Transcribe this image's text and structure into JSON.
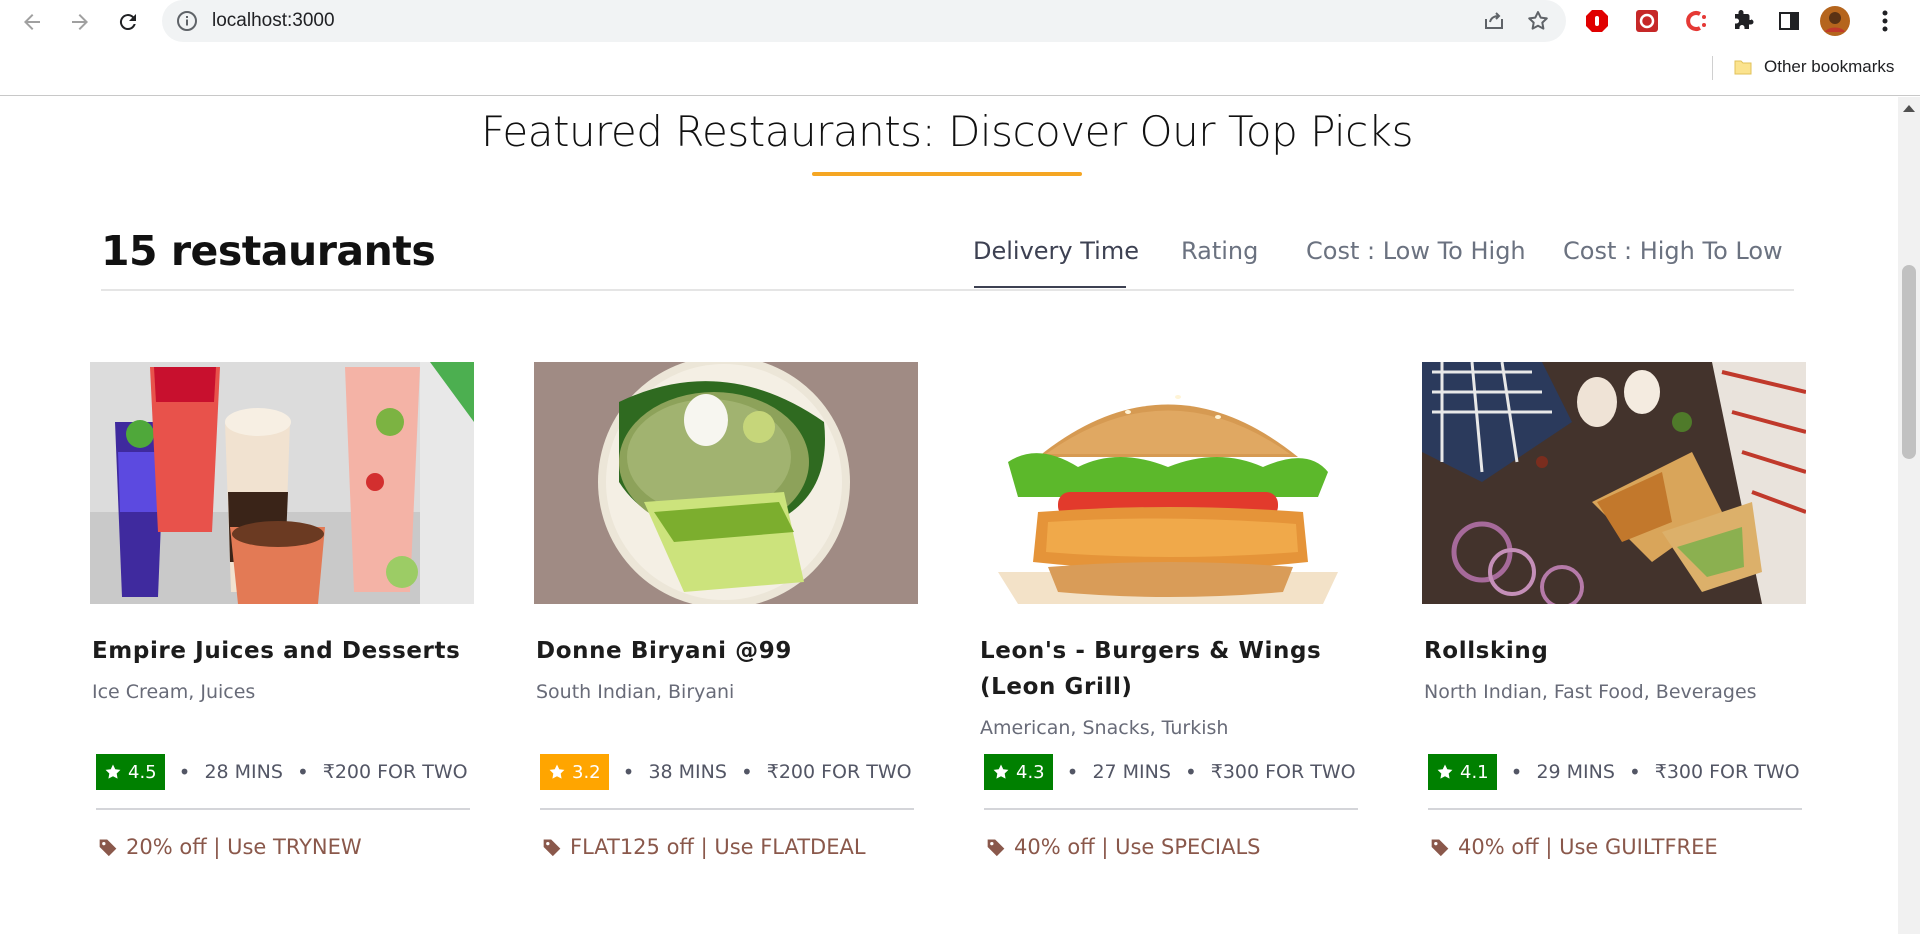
{
  "browser": {
    "url": "localhost:3000",
    "bookmarks_label": "Other bookmarks"
  },
  "page": {
    "heading": "Featured Restaurants: Discover Our Top Picks",
    "count_label": "15 restaurants",
    "sort_tabs": [
      "Delivery Time",
      "Rating",
      "Cost : Low To High",
      "Cost : High To Low"
    ],
    "active_sort": "Delivery Time",
    "accent_color": "#f5a623"
  },
  "restaurants": [
    {
      "name": "Empire Juices and Desserts",
      "cuisine": "Ice Cream, Juices",
      "rating": "4.5",
      "rating_color": "#008000",
      "time": "28 MINS",
      "cost": "₹200 FOR TWO",
      "offer": "20% off | Use TRYNEW",
      "image": "juices-desserts-photo"
    },
    {
      "name": "Donne Biryani @99",
      "cuisine": "South Indian, Biryani",
      "rating": "3.2",
      "rating_color": "#ffa500",
      "time": "38 MINS",
      "cost": "₹200 FOR TWO",
      "offer": "FLAT125 off | Use FLATDEAL",
      "image": "biryani-photo"
    },
    {
      "name": "Leon's - Burgers & Wings (Leon Grill)",
      "cuisine": "American, Snacks, Turkish",
      "rating": "4.3",
      "rating_color": "#008000",
      "time": "27 MINS",
      "cost": "₹300 FOR TWO",
      "offer": "40% off | Use SPECIALS",
      "image": "burger-photo"
    },
    {
      "name": "Rollsking",
      "cuisine": "North Indian, Fast Food, Beverages",
      "rating": "4.1",
      "rating_color": "#008000",
      "time": "29 MINS",
      "cost": "₹300 FOR TWO",
      "offer": "40% off | Use GUILTFREE",
      "image": "rolls-photo"
    }
  ]
}
